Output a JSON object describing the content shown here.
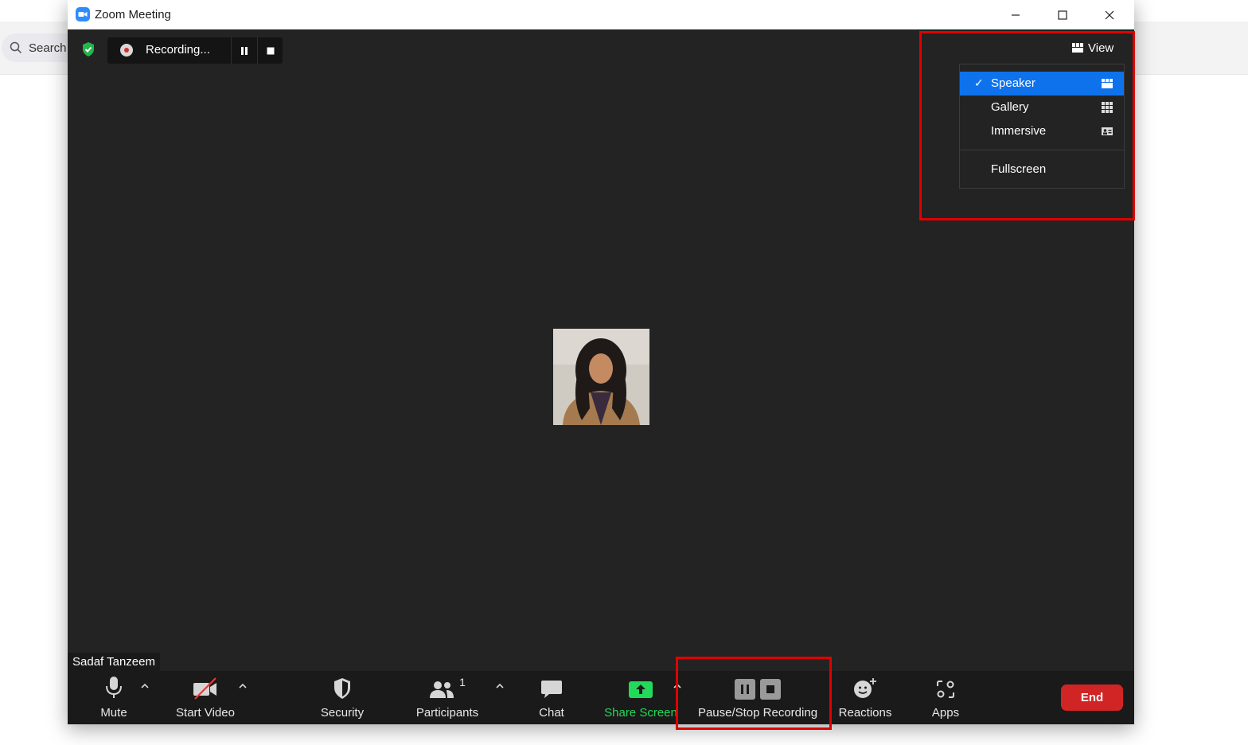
{
  "background_app": {
    "search_label": "Search"
  },
  "window": {
    "title": "Zoom Meeting"
  },
  "recording_bar": {
    "status": "Recording..."
  },
  "view_menu": {
    "button_label": "View",
    "items": [
      {
        "label": "Speaker",
        "selected": true,
        "icon": "speaker-view-icon"
      },
      {
        "label": "Gallery",
        "selected": false,
        "icon": "gallery-grid-icon"
      },
      {
        "label": "Immersive",
        "selected": false,
        "icon": "immersive-view-icon"
      },
      {
        "label": "Fullscreen",
        "selected": false,
        "icon": ""
      }
    ]
  },
  "participant": {
    "name": "Sadaf Tanzeem"
  },
  "toolbar": {
    "mute": "Mute",
    "start_video": "Start Video",
    "security": "Security",
    "participants": "Participants",
    "participants_count": "1",
    "chat": "Chat",
    "share_screen": "Share Screen",
    "pause_stop_recording": "Pause/Stop Recording",
    "reactions": "Reactions",
    "apps": "Apps",
    "end": "End"
  },
  "colors": {
    "accent_blue": "#0e72ed",
    "share_green": "#23d959",
    "end_red": "#d12525",
    "highlight_red": "#e00000",
    "stage_bg": "#232323"
  }
}
